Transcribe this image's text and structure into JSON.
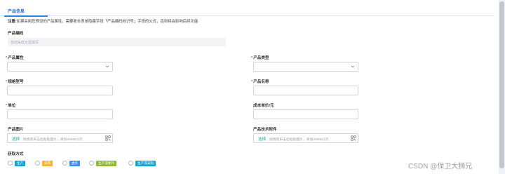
{
  "tab": {
    "label": "产品信息"
  },
  "notice": {
    "prefix": "注意:",
    "text": "如果采用您预设的产品属性，需要新本表单隐藏字段「产品编码标识号」字段的公式，否则将会影响后续功能"
  },
  "product_code": {
    "label": "产品编码",
    "placeholder": "自动生成无需填写"
  },
  "product_attr": {
    "label": "产品属性",
    "required": true,
    "value": ""
  },
  "product_type": {
    "label": "产品类型",
    "required": true,
    "value": ""
  },
  "spec_model": {
    "label": "规格型号",
    "required": true,
    "value": ""
  },
  "product_name": {
    "label": "产品名称",
    "required": true,
    "value": ""
  },
  "unit": {
    "label": "单位",
    "required": true,
    "value": ""
  },
  "cost_price": {
    "label": "成本单价/元",
    "required": false,
    "value": ""
  },
  "product_image": {
    "label": "产品图片",
    "button": "选择",
    "hint": "拖拽或单击后粘贴图片，单张20MB以内"
  },
  "product_attachment": {
    "label": "产品技术附件",
    "button": "选择",
    "hint": "拖拽或单击后粘贴图片，单张20MB以内"
  },
  "acquisition": {
    "label": "获取方式",
    "options": [
      {
        "label": "生产",
        "color": "#15a6d6"
      },
      {
        "label": "采购",
        "color": "#f5b42a"
      },
      {
        "label": "委外",
        "color": "#3c8ff0"
      },
      {
        "label": "生产或委外",
        "color": "#8dbb2b"
      },
      {
        "label": "生产或采购",
        "color": "#15a6d6"
      }
    ]
  },
  "watermark": "CSDN @保卫大狮兄",
  "colors": {
    "accent": "#2f7fe0",
    "required": "#e0463f",
    "upload": "#1aaf8c"
  }
}
